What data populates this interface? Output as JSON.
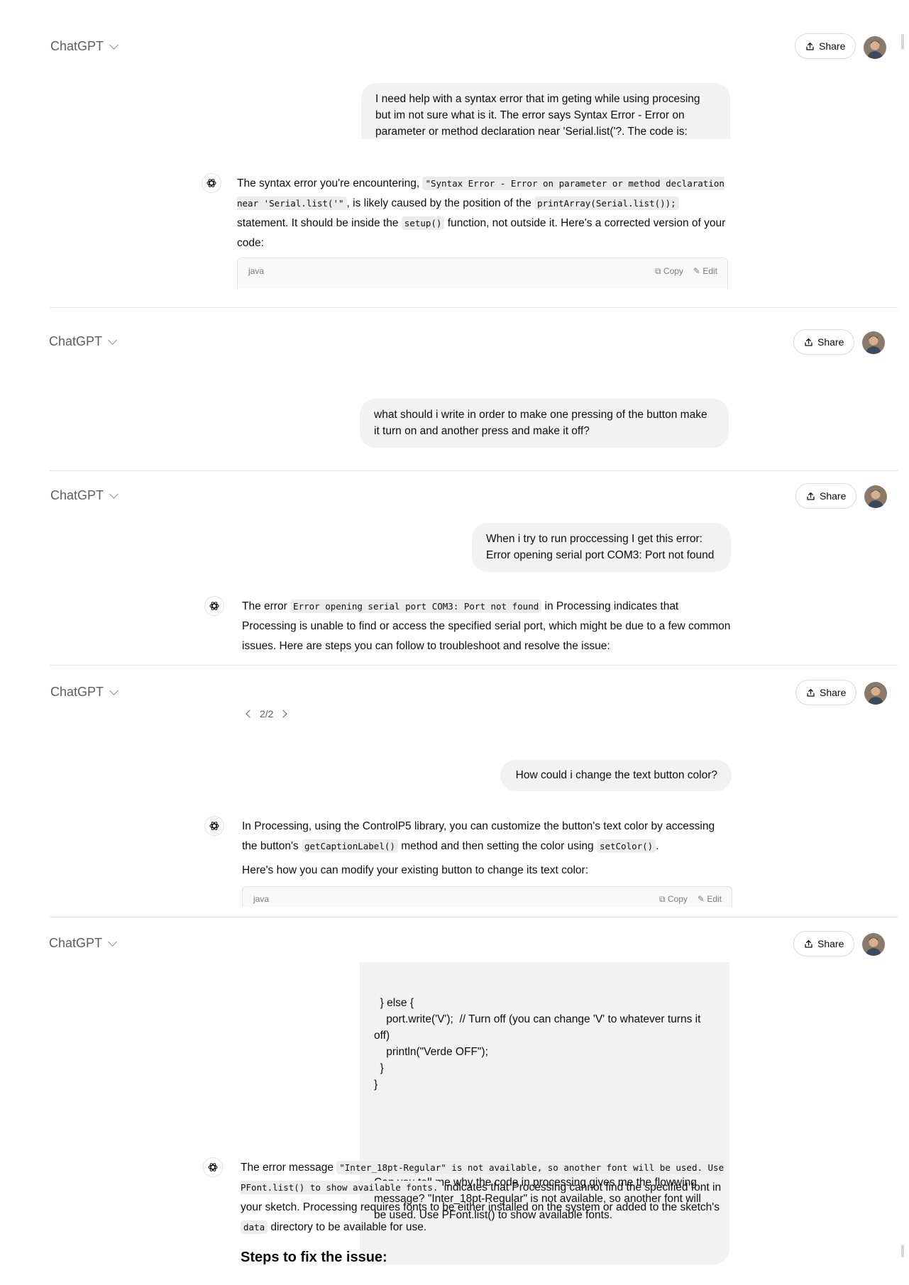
{
  "app": {
    "brand": "ChatGPT",
    "share_label": "Share"
  },
  "panel1": {
    "user_message": "I need help with a syntax error that im geting while using procesing but im not sure what is it. The error says Syntax Error - Error on parameter or method declaration near 'Serial.list('?. The code is:",
    "assistant": {
      "t1": "The syntax error you're encountering, ",
      "c1": "\"Syntax Error - Error on parameter or method declaration near 'Serial.list('\"",
      "t2": ", is likely caused by the position of the ",
      "c2": "printArray(Serial.list());",
      "t3": " statement. It should be inside the ",
      "c3": "setup()",
      "t4": " function, not outside it. Here's a corrected version of your code:"
    },
    "code_lang": "java",
    "copy_label": "Copy",
    "edit_label": "Edit"
  },
  "panel2": {
    "user_message": "what should i write in order to make one pressing of the button make it turn on and another press and make it off?"
  },
  "panel3": {
    "user_message_line1": "When i try to run proccessing I get this error:",
    "user_message_line2": "Error opening serial port COM3: Port not found",
    "assistant": {
      "t1": "The error ",
      "c1": "Error opening serial port COM3: Port not found",
      "t2": " in Processing indicates that Processing is unable to find or access the specified serial port, which might be due to a few common issues. Here are steps you can follow to troubleshoot and resolve the issue:"
    }
  },
  "panel4": {
    "pager": "2/2",
    "user_message": "How could i change the text button color?",
    "assistant": {
      "t1": "In Processing, using the ControlP5 library, you can customize the button's text color by accessing the button's ",
      "c1": "getCaptionLabel()",
      "t2": " method and then setting the color using ",
      "c2": "setColor()",
      "t3": ".",
      "p2": "Here's how you can modify your existing button to change its text color:"
    },
    "code_lang": "java",
    "copy_label": "Copy",
    "edit_label": "Edit"
  },
  "panel5": {
    "user_code_lines": [
      "  } else {",
      "    port.write('V');  // Turn off (you can change 'V' to whatever turns it off)",
      "    println(\"Verde OFF\");",
      "  }",
      "}"
    ],
    "user_question": "Can you tell me why the code in processing gives me the flowwing message? \"Inter_18pt-Regular\" is not available, so another font will be used. Use PFont.list() to show available fonts.",
    "assistant": {
      "t1": "The error message ",
      "c1": "\"Inter_18pt-Regular\" is not available, so another font will be used. Use PFont.list() to show available fonts.",
      "t2": " indicates that Processing cannot find the specified font in your sketch. Processing requires fonts to be either installed on the system or added to the sketch's ",
      "c2": "data",
      "t3": " directory to be available for use."
    },
    "steps_heading": "Steps to fix the issue:"
  },
  "colors": {
    "bubble": "#f2f2f2",
    "divider": "#e3e3e3",
    "code_bg": "#ececec"
  },
  "icons": [
    "chevron-down-icon",
    "share-icon",
    "avatar",
    "chatgpt-logo-icon",
    "copy-icon",
    "edit-icon",
    "chevron-left-icon",
    "chevron-right-icon"
  ]
}
